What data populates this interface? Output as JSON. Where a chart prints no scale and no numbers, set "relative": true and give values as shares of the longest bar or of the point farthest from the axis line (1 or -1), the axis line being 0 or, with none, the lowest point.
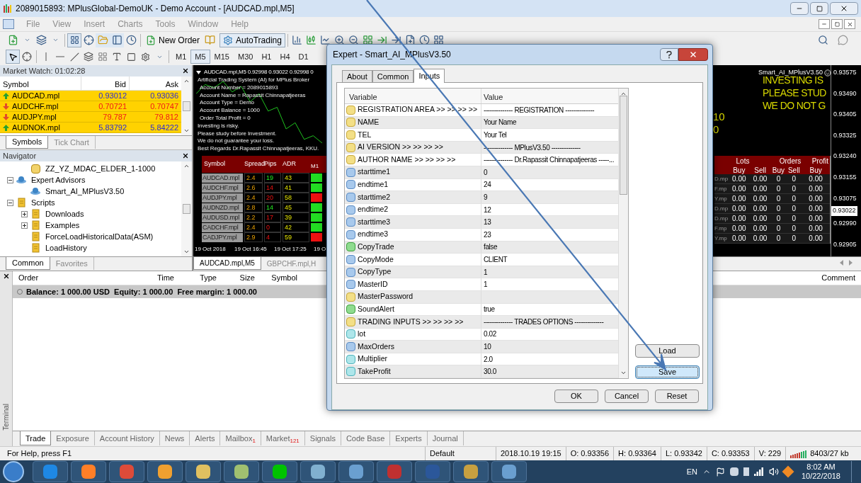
{
  "window": {
    "title": "2089015893: MPlusGlobal-DemoUK - Demo Account - [AUDCAD.mpl,M5]"
  },
  "menu": [
    {
      "label": "File",
      "disabled": true
    },
    {
      "label": "View",
      "disabled": true
    },
    {
      "label": "Insert",
      "disabled": true
    },
    {
      "label": "Charts",
      "disabled": true
    },
    {
      "label": "Tools",
      "disabled": true
    },
    {
      "label": "Window",
      "disabled": true
    },
    {
      "label": "Help",
      "disabled": true
    }
  ],
  "toolbar": {
    "new_order": "New Order",
    "autotrading": "AutoTrading",
    "timeframes": [
      {
        "label": "M1",
        "selected": false
      },
      {
        "label": "M5",
        "selected": true
      },
      {
        "label": "M15",
        "selected": false
      },
      {
        "label": "M30",
        "selected": false
      },
      {
        "label": "H1",
        "selected": false
      },
      {
        "label": "H4",
        "selected": false
      },
      {
        "label": "D1",
        "selected": false
      }
    ]
  },
  "market_watch": {
    "title": "Market Watch: 01:02:28",
    "columns": [
      "Symbol",
      "Bid",
      "Ask"
    ],
    "rows": [
      {
        "symbol": "AUDCAD.mpl",
        "bid": "0.93012",
        "ask": "0.93036",
        "rising": true
      },
      {
        "symbol": "AUDCHF.mpl",
        "bid": "0.70721",
        "ask": "0.70747",
        "rising": false
      },
      {
        "symbol": "AUDJPY.mpl",
        "bid": "79.787",
        "ask": "79.812",
        "rising": false
      },
      {
        "symbol": "AUDNOK.mpl",
        "bid": "5.83792",
        "ask": "5.84222",
        "rising": true
      }
    ],
    "tabs": [
      {
        "label": "Symbols",
        "selected": true
      },
      {
        "label": "Tick Chart",
        "selected": false
      }
    ]
  },
  "navigator": {
    "title": "Navigator",
    "tree": [
      {
        "label": "ZZ_YZ_MDAC_ELDER_1-1000",
        "kind": "indicator"
      },
      {
        "label": "Expert Advisors",
        "kind": "experts",
        "expanded": true,
        "children": [
          {
            "label": "Smart_AI_MPlusV3.50",
            "kind": "expert"
          }
        ]
      },
      {
        "label": "Scripts",
        "kind": "scripts",
        "expanded": true,
        "children": [
          {
            "label": "Downloads",
            "kind": "scripts",
            "expanded": false
          },
          {
            "label": "Examples",
            "kind": "scripts",
            "expanded": false
          },
          {
            "label": "ForceLoadHistoricalData(ASM)",
            "kind": "script"
          },
          {
            "label": "LoadHistory",
            "kind": "script"
          }
        ]
      }
    ],
    "tabs": [
      {
        "label": "Common",
        "selected": true
      },
      {
        "label": "Favorites",
        "selected": false
      }
    ]
  },
  "chart": {
    "header": "AUDCAD.mpl,M5  0.92998 0.93022 0.92998 0",
    "info": [
      "Artificial Trading System (AI) for MPlus Broker",
      "Account Number = 2089015893",
      "Account Name = Rapassit Chinnapatjeeras",
      "Account Type = Demo",
      "Account Balance = 1000",
      "Order Total Profit = 0",
      "Investing is risky.",
      "Please study before Investment.",
      "We do not guarantee your loss.",
      "Best Regards Dr.Rapassit Chinnapatjeeras, KKU."
    ],
    "signal_table": {
      "columns": [
        "Symbol",
        "Spread",
        "Pips",
        "ADR",
        "M1"
      ],
      "rows": [
        {
          "symbol": "AUDCAD.mpl",
          "spread": "2.4",
          "pips": "19",
          "adr": "43",
          "pips_up": true,
          "m1_up": true
        },
        {
          "symbol": "AUDCHF.mpl",
          "spread": "2.6",
          "pips": "14",
          "adr": "41",
          "pips_up": false,
          "m1_up": true
        },
        {
          "symbol": "AUDJPY.mpl",
          "spread": "2.4",
          "pips": "20",
          "adr": "58",
          "pips_up": false,
          "m1_up": false
        },
        {
          "symbol": "AUDNZD.mpl",
          "spread": "2.8",
          "pips": "14",
          "adr": "45",
          "pips_up": true,
          "m1_up": true
        },
        {
          "symbol": "AUDUSD.mpl",
          "spread": "2.2",
          "pips": "17",
          "adr": "39",
          "pips_up": false,
          "m1_up": true
        },
        {
          "symbol": "CADCHF.mpl",
          "spread": "2.4",
          "pips": "0",
          "adr": "42",
          "pips_up": false,
          "m1_up": true
        },
        {
          "symbol": "CADJPY.mpl",
          "spread": "2.9",
          "pips": "4",
          "adr": "59",
          "pips_up": false,
          "m1_up": false
        }
      ]
    },
    "ea_label": "Smart_AI_MPlusV3.50",
    "warnings": [
      "INVESTING IS",
      "PLEASE STUD",
      "WE DO NOT G"
    ],
    "counters": [
      "10",
      "0"
    ],
    "orders_table": {
      "groups": [
        "Lots",
        "Orders",
        "Profit"
      ],
      "subcolumns": [
        "Buy",
        "Sell",
        "Buy",
        "Sell",
        "Buy"
      ],
      "rows": [
        {
          "symbol": "D.mp",
          "cells": [
            "0.00",
            "0.00",
            "0",
            "0",
            "0.00"
          ]
        },
        {
          "symbol": "F.mp",
          "cells": [
            "0.00",
            "0.00",
            "0",
            "0",
            "0.00"
          ]
        },
        {
          "symbol": "Y.mp",
          "cells": [
            "0.00",
            "0.00",
            "0",
            "0",
            "0.00"
          ]
        },
        {
          "symbol": "D.mp",
          "cells": [
            "0.00",
            "0.00",
            "0",
            "0",
            "0.00"
          ]
        },
        {
          "symbol": "D.mp",
          "cells": [
            "0.00",
            "0.00",
            "0",
            "0",
            "0.00"
          ]
        },
        {
          "symbol": "F.mp",
          "cells": [
            "0.00",
            "0.00",
            "0",
            "0",
            "0.00"
          ]
        },
        {
          "symbol": "Y.mp",
          "cells": [
            "0.00",
            "0.00",
            "0",
            "0",
            "0.00"
          ]
        }
      ]
    },
    "price_axis": [
      "0.93575",
      "0.93490",
      "0.93405",
      "0.93325",
      "0.93240",
      "0.93155",
      "0.93075",
      "0.92990",
      "0.92905"
    ],
    "chart_data": {
      "type": "line",
      "relative": true,
      "categories": [
        null,
        null,
        null,
        null,
        null,
        null,
        null,
        null,
        null,
        null,
        null,
        null,
        null,
        null,
        null
      ],
      "series": [
        {
          "color": "#1fc21f",
          "values": [
            0.8,
            0.95,
            0.9,
            1.0,
            0.83,
            0.92,
            0.67,
            0.8,
            0.52,
            0.58,
            0.23,
            0.33,
            0.06,
            0.12,
            0.0
          ]
        }
      ]
    },
    "current_price": "0.93022",
    "time_axis": [
      "19 Oct 2018",
      "19 Oct 16:45",
      "19 Oct 17:25",
      "19 O"
    ],
    "tabs": [
      {
        "label": "AUDCAD.mpl,M5",
        "selected": true
      },
      {
        "label": "GBPCHF.mpl,H",
        "selected": false
      }
    ]
  },
  "dialog": {
    "title": "Expert - Smart_AI_MPlusV3.50",
    "tabs": [
      {
        "label": "About",
        "selected": false
      },
      {
        "label": "Common",
        "selected": false
      },
      {
        "label": "Inputs",
        "selected": true
      }
    ],
    "columns": [
      "Variable",
      "Value"
    ],
    "rows": [
      {
        "kind": "string",
        "variable": "REGISTRATION AREA >> >> >> >>",
        "value": "-------------- REGISTRATION --------------"
      },
      {
        "kind": "string",
        "variable": "NAME",
        "value": "Your Name"
      },
      {
        "kind": "string",
        "variable": "TEL",
        "value": "Your Tel"
      },
      {
        "kind": "string",
        "variable": "AI VERSION >> >> >> >>",
        "value": "-------------- MPlusV3.50 --------------"
      },
      {
        "kind": "string",
        "variable": "AUTHOR NAME >> >> >> >>",
        "value": "-------------- Dr.Rapassit Chinnapatjeeras -----..."
      },
      {
        "kind": "int",
        "variable": "starttime1",
        "value": "0"
      },
      {
        "kind": "int",
        "variable": "endtime1",
        "value": "24"
      },
      {
        "kind": "int",
        "variable": "starttime2",
        "value": "9"
      },
      {
        "kind": "int",
        "variable": "endtime2",
        "value": "12"
      },
      {
        "kind": "int",
        "variable": "starttime3",
        "value": "13"
      },
      {
        "kind": "int",
        "variable": "endtime3",
        "value": "23"
      },
      {
        "kind": "bool",
        "variable": "CopyTrade",
        "value": "false"
      },
      {
        "kind": "int",
        "variable": "CopyMode",
        "value": "CLIENT"
      },
      {
        "kind": "int",
        "variable": "CopyType",
        "value": "1"
      },
      {
        "kind": "int",
        "variable": "MasterID",
        "value": "1"
      },
      {
        "kind": "string",
        "variable": "MasterPassword"
      },
      {
        "kind": "bool",
        "variable": "SoundAlert",
        "value": "true"
      },
      {
        "kind": "string",
        "variable": "TRADING INPUTS >> >> >> >>",
        "value": "-------------- TRADES OPTIONS --------------"
      },
      {
        "kind": "double",
        "variable": "lot",
        "value": "0.02"
      },
      {
        "kind": "int",
        "variable": "MaxOrders",
        "value": "10"
      },
      {
        "kind": "double",
        "variable": "Multiplier",
        "value": "2.0"
      },
      {
        "kind": "double",
        "variable": "TakeProfit",
        "value": "30.0"
      }
    ],
    "side_buttons": [
      {
        "label": "Load",
        "focused": false
      },
      {
        "label": "Save",
        "focused": true
      }
    ],
    "buttons": [
      "OK",
      "Cancel",
      "Reset"
    ]
  },
  "terminal": {
    "label": "Terminal",
    "columns": [
      "Order",
      "Time",
      "Type",
      "Size",
      "Symbol",
      "Comment"
    ],
    "balance": "Balance: 1 000.00 USD  Equity: 1 000.00  Free margin: 1 000.00",
    "tabs": [
      {
        "label": "Trade",
        "selected": true
      },
      {
        "label": "Exposure",
        "selected": false
      },
      {
        "label": "Account History",
        "selected": false
      },
      {
        "label": "News",
        "selected": false
      },
      {
        "label": "Alerts",
        "selected": false
      },
      {
        "label": "Mailbox",
        "badge": "1",
        "selected": false
      },
      {
        "label": "Market",
        "badge": "121",
        "selected": false
      },
      {
        "label": "Signals",
        "selected": false
      },
      {
        "label": "Code Base",
        "selected": false
      },
      {
        "label": "Experts",
        "selected": false
      },
      {
        "label": "Journal",
        "selected": false
      }
    ]
  },
  "status_bar": {
    "help": "For Help, press F1",
    "profile": "Default",
    "datetime": "2018.10.19 19:15",
    "ohlcv": [
      "O: 0.93356",
      "H: 0.93364",
      "L: 0.93342",
      "C: 0.93353",
      "V: 229"
    ],
    "traffic": "8403/27 kb"
  },
  "taskbar": {
    "language": "EN",
    "time": "8:02 AM",
    "date": "10/22/2018"
  }
}
